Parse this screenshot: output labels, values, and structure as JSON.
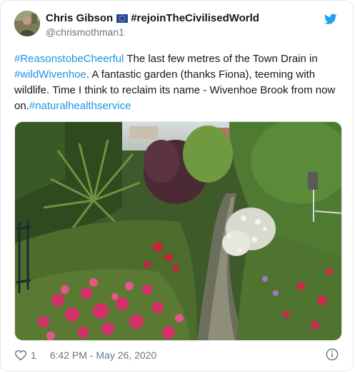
{
  "tweet": {
    "author": {
      "display_name": "Chris Gibson",
      "flag_icon": "eu-flag-icon",
      "name_suffix": "#rejoinTheCivilisedWorld",
      "handle": "@chrismothman1"
    },
    "brand_icon": "twitter-bird-icon",
    "text_parts": {
      "hashtag1": "#ReasonstobeCheerful",
      "text1": " The last few metres of the Town Drain in ",
      "hashtag2": "#wildWivenhoe",
      "text2": ". A fantastic garden (thanks Fiona), teeming with wildlife. Time I think to reclaim its name - Wivenhoe Brook from now on.",
      "hashtag3": "#naturalhealthservice"
    },
    "media": {
      "type": "photo",
      "subject": "garden-stream-photo"
    },
    "footer": {
      "like_icon": "heart-icon",
      "like_count": "1",
      "timestamp": "6:42 PM - May 26, 2020",
      "info_icon": "info-icon"
    }
  },
  "colors": {
    "link": "#1b95e0",
    "text": "#14171a",
    "muted": "#657786",
    "border": "#e1e8ed",
    "twitter_blue": "#1da1f2"
  }
}
